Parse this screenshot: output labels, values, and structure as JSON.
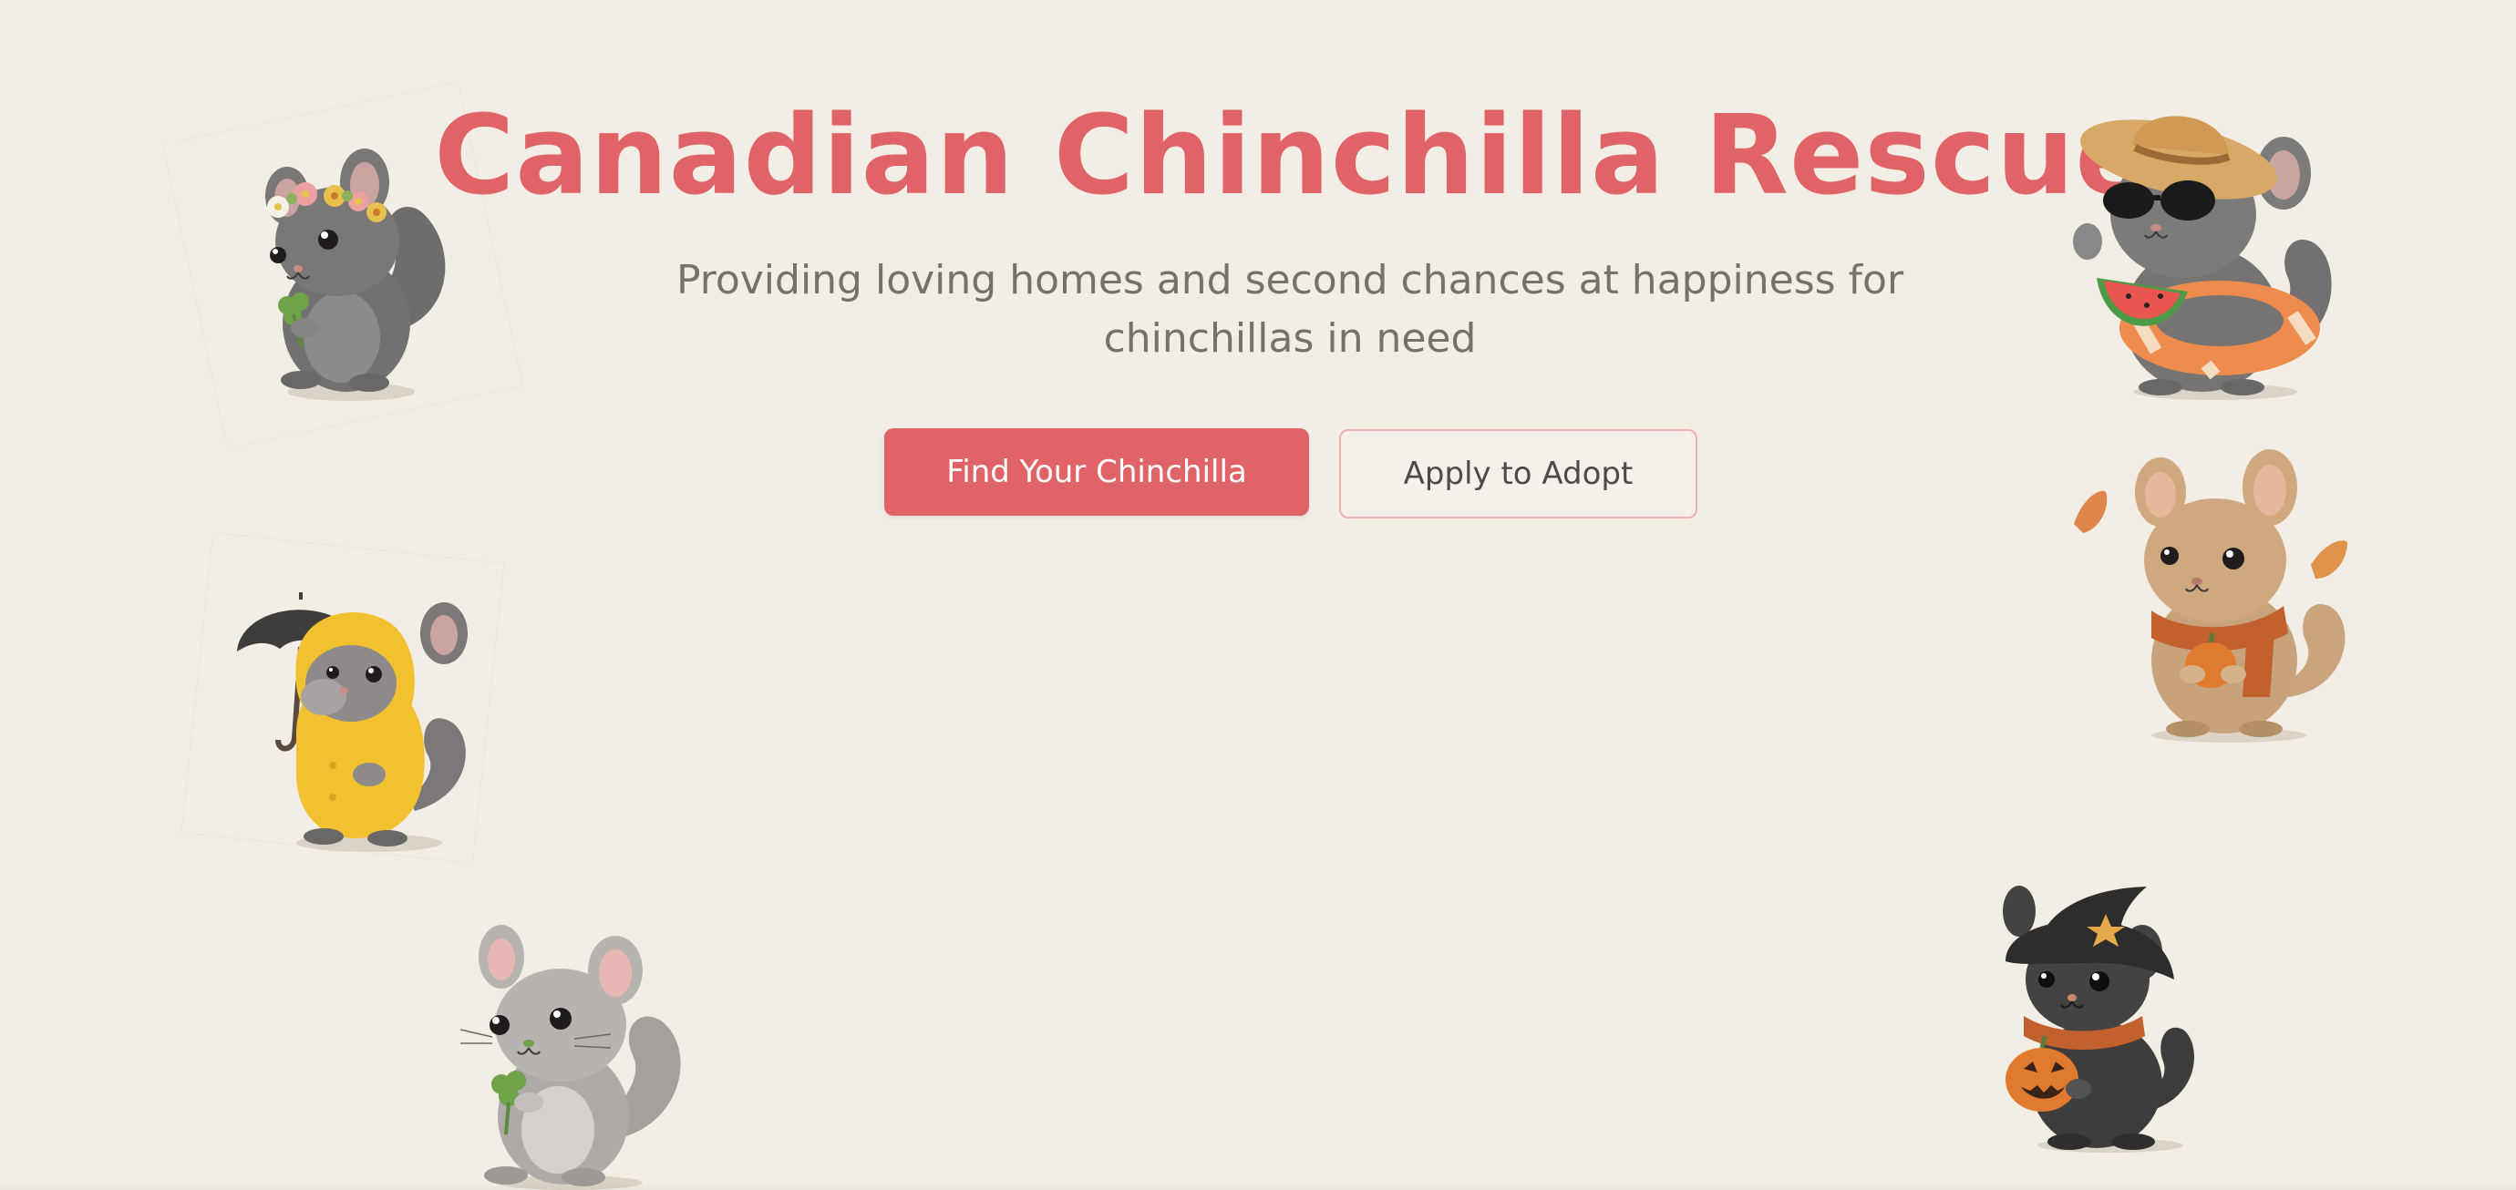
{
  "hero": {
    "title": "Canadian Chinchilla Rescue",
    "subtitle": "Providing loving homes and second chances at happiness for chinchillas in need",
    "primary_button": "Find Your Chinchilla",
    "secondary_button": "Apply to Adopt"
  },
  "colors": {
    "background": "#f2eee5",
    "accent": "#e06467",
    "subtitle_text": "#77716c",
    "secondary_border": "#eab1ad"
  },
  "decorations": [
    {
      "name": "spring-flower-crown-chinchilla",
      "icon": "chinchilla-with-flower-crown-and-clover"
    },
    {
      "name": "rain-raincoat-chinchilla",
      "icon": "chinchilla-in-yellow-raincoat-with-umbrella"
    },
    {
      "name": "clover-chinchilla",
      "icon": "chinchilla-holding-clover"
    },
    {
      "name": "summer-beach-chinchilla",
      "icon": "chinchilla-with-sunhat-sunglasses-swim-ring-watermelon"
    },
    {
      "name": "autumn-scarf-chinchilla",
      "icon": "chinchilla-with-scarf-pumpkin-and-leaves"
    },
    {
      "name": "halloween-witch-chinchilla",
      "icon": "chinchilla-with-witch-hat-and-jack-o-lantern"
    }
  ]
}
